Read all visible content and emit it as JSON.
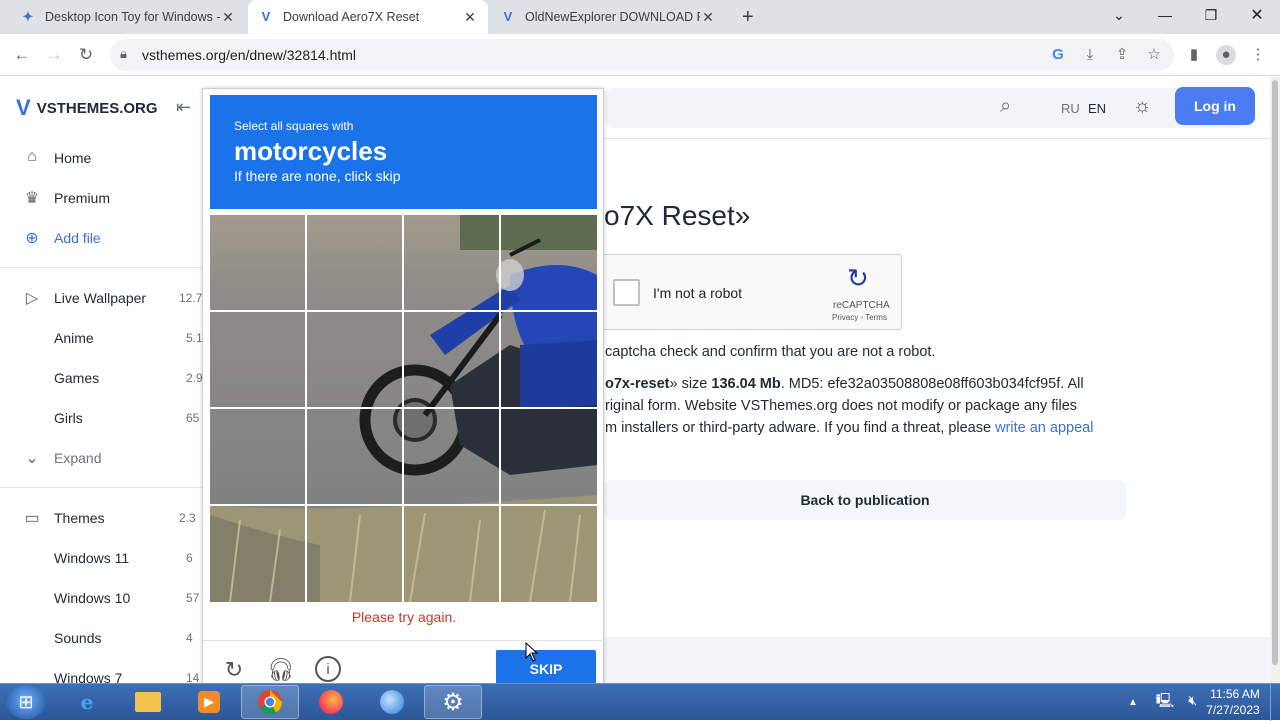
{
  "browser": {
    "tabs": [
      {
        "title": "Desktop Icon Toy for Windows - ",
        "favicon": "bird-icon",
        "active": false
      },
      {
        "title": "Download Aero7X Reset",
        "favicon": "vsthemes-icon",
        "active": true
      },
      {
        "title": "OldNewExplorer DOWNLOAD FR",
        "favicon": "vsthemes-icon",
        "active": false
      }
    ],
    "new_tab_label": "+",
    "url": "vsthemes.org/en/dnew/32814.html"
  },
  "site": {
    "logo_text": "VSTHEMES.ORG",
    "lang_ru": "RU",
    "lang_en": "EN",
    "login_label": "Log in"
  },
  "sidebar": {
    "top_items": [
      {
        "label": "Home",
        "icon": "home-icon"
      },
      {
        "label": "Premium",
        "icon": "crown-icon"
      },
      {
        "label": "Add file",
        "icon": "plus-circle-icon"
      }
    ],
    "live_wallpaper": {
      "label": "Live Wallpaper",
      "count": "12.7"
    },
    "live_sub": [
      {
        "label": "Anime",
        "count": "5.1"
      },
      {
        "label": "Games",
        "count": "2.9"
      },
      {
        "label": "Girls",
        "count": "65"
      }
    ],
    "expand_label": "Expand",
    "themes": {
      "label": "Themes",
      "count": "2.3"
    },
    "themes_sub": [
      {
        "label": "Windows 11",
        "count": "6"
      },
      {
        "label": "Windows 10",
        "count": "57"
      },
      {
        "label": "Sounds",
        "count": "4"
      },
      {
        "label": "Windows 7",
        "count": "14"
      }
    ]
  },
  "content": {
    "title_partial": "o7X Reset»",
    "recaptcha_label": "I'm not a robot",
    "recaptcha_brand": "reCAPTCHA",
    "recaptcha_terms": "Privacy - Terms",
    "line1": "captcha check and confirm that you are not a robot.",
    "line2_name": "o7x-reset",
    "line2_mid": "» size ",
    "line2_size": "136.04 Mb",
    "line2_end": ". MD5: efe32a03508808e08ff603b034fcf95f. All",
    "line3": "riginal form. Website VSThemes.org does not modify or package any files",
    "line4": "m installers or third-party adware. If you find a threat, please ",
    "line4_link": "write an appeal",
    "back_label": "Back to publication"
  },
  "challenge": {
    "select_text": "Select all squares with",
    "object": "motorcycles",
    "none_text": "If there are none, click skip",
    "error": "Please try again.",
    "skip_label": "SKIP"
  },
  "taskbar": {
    "apps": [
      "internet-explorer-icon",
      "file-explorer-icon",
      "media-player-icon",
      "chrome-icon",
      "firefox-icon",
      "thunderbird-icon",
      "settings-gear-icon"
    ],
    "time": "11:56 AM",
    "date": "7/27/2023"
  },
  "colors": {
    "accent": "#4a7cf3",
    "captcha_blue": "#1a73e8",
    "error_red": "#c0392b",
    "taskbar": "#2b5797"
  }
}
